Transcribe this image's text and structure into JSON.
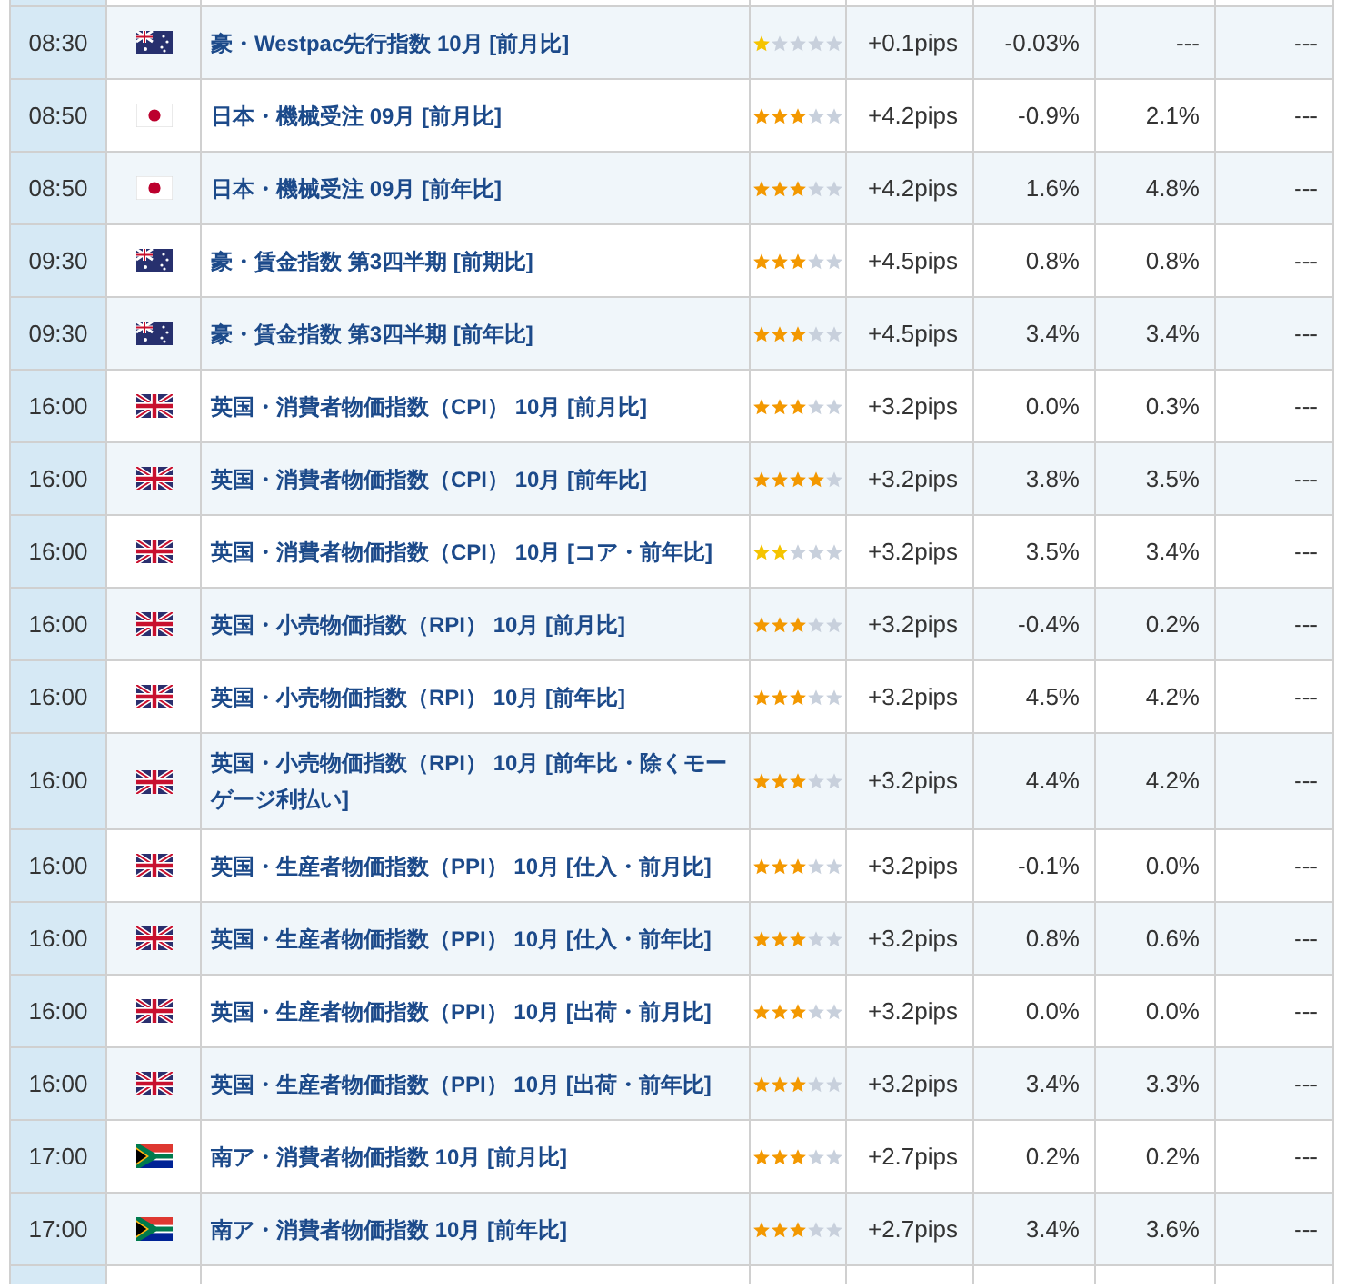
{
  "rows": [
    {
      "time": "08:30",
      "kind": "au",
      "name": "豪・Westpac先行指数 10月 [前月比]",
      "stars": 1,
      "pips": "+0.1pips",
      "forecast": "-0.03%",
      "previous": "---",
      "result": "---"
    },
    {
      "time": "08:50",
      "kind": "jp",
      "name": "日本・機械受注 09月 [前月比]",
      "stars": 3,
      "pips": "+4.2pips",
      "forecast": "-0.9%",
      "previous": "2.1%",
      "result": "---"
    },
    {
      "time": "08:50",
      "kind": "jp",
      "name": "日本・機械受注 09月 [前年比]",
      "stars": 3,
      "pips": "+4.2pips",
      "forecast": "1.6%",
      "previous": "4.8%",
      "result": "---"
    },
    {
      "time": "09:30",
      "kind": "au",
      "name": "豪・賃金指数 第3四半期 [前期比]",
      "stars": 3,
      "pips": "+4.5pips",
      "forecast": "0.8%",
      "previous": "0.8%",
      "result": "---"
    },
    {
      "time": "09:30",
      "kind": "au",
      "name": "豪・賃金指数 第3四半期 [前年比]",
      "stars": 3,
      "pips": "+4.5pips",
      "forecast": "3.4%",
      "previous": "3.4%",
      "result": "---"
    },
    {
      "time": "16:00",
      "kind": "gb",
      "name": "英国・消費者物価指数（CPI） 10月 [前月比]",
      "stars": 3,
      "pips": "+3.2pips",
      "forecast": "0.0%",
      "previous": "0.3%",
      "result": "---"
    },
    {
      "time": "16:00",
      "kind": "gb",
      "name": "英国・消費者物価指数（CPI） 10月 [前年比]",
      "stars": 4,
      "pips": "+3.2pips",
      "forecast": "3.8%",
      "previous": "3.5%",
      "result": "---"
    },
    {
      "time": "16:00",
      "kind": "gb",
      "name": "英国・消費者物価指数（CPI） 10月 [コア・前年比]",
      "stars": 2,
      "pips": "+3.2pips",
      "forecast": "3.5%",
      "previous": "3.4%",
      "result": "---"
    },
    {
      "time": "16:00",
      "kind": "gb",
      "name": "英国・小売物価指数（RPI） 10月 [前月比]",
      "stars": 3,
      "pips": "+3.2pips",
      "forecast": "-0.4%",
      "previous": "0.2%",
      "result": "---"
    },
    {
      "time": "16:00",
      "kind": "gb",
      "name": "英国・小売物価指数（RPI） 10月 [前年比]",
      "stars": 3,
      "pips": "+3.2pips",
      "forecast": "4.5%",
      "previous": "4.2%",
      "result": "---"
    },
    {
      "time": "16:00",
      "kind": "gb",
      "name": "英国・小売物価指数（RPI） 10月 [前年比・除くモーゲージ利払い]",
      "stars": 3,
      "pips": "+3.2pips",
      "forecast": "4.4%",
      "previous": "4.2%",
      "result": "---"
    },
    {
      "time": "16:00",
      "kind": "gb",
      "name": "英国・生産者物価指数（PPI） 10月 [仕入・前月比]",
      "stars": 3,
      "pips": "+3.2pips",
      "forecast": "-0.1%",
      "previous": "0.0%",
      "result": "---"
    },
    {
      "time": "16:00",
      "kind": "gb",
      "name": "英国・生産者物価指数（PPI） 10月 [仕入・前年比]",
      "stars": 3,
      "pips": "+3.2pips",
      "forecast": "0.8%",
      "previous": "0.6%",
      "result": "---"
    },
    {
      "time": "16:00",
      "kind": "gb",
      "name": "英国・生産者物価指数（PPI） 10月 [出荷・前月比]",
      "stars": 3,
      "pips": "+3.2pips",
      "forecast": "0.0%",
      "previous": "0.0%",
      "result": "---"
    },
    {
      "time": "16:00",
      "kind": "gb",
      "name": "英国・生産者物価指数（PPI） 10月 [出荷・前年比]",
      "stars": 3,
      "pips": "+3.2pips",
      "forecast": "3.4%",
      "previous": "3.3%",
      "result": "---"
    },
    {
      "time": "17:00",
      "kind": "za",
      "name": "南ア・消費者物価指数 10月 [前月比]",
      "stars": 3,
      "pips": "+2.7pips",
      "forecast": "0.2%",
      "previous": "0.2%",
      "result": "---"
    },
    {
      "time": "17:00",
      "kind": "za",
      "name": "南ア・消費者物価指数 10月 [前年比]",
      "stars": 3,
      "pips": "+2.7pips",
      "forecast": "3.4%",
      "previous": "3.6%",
      "result": "---"
    }
  ]
}
